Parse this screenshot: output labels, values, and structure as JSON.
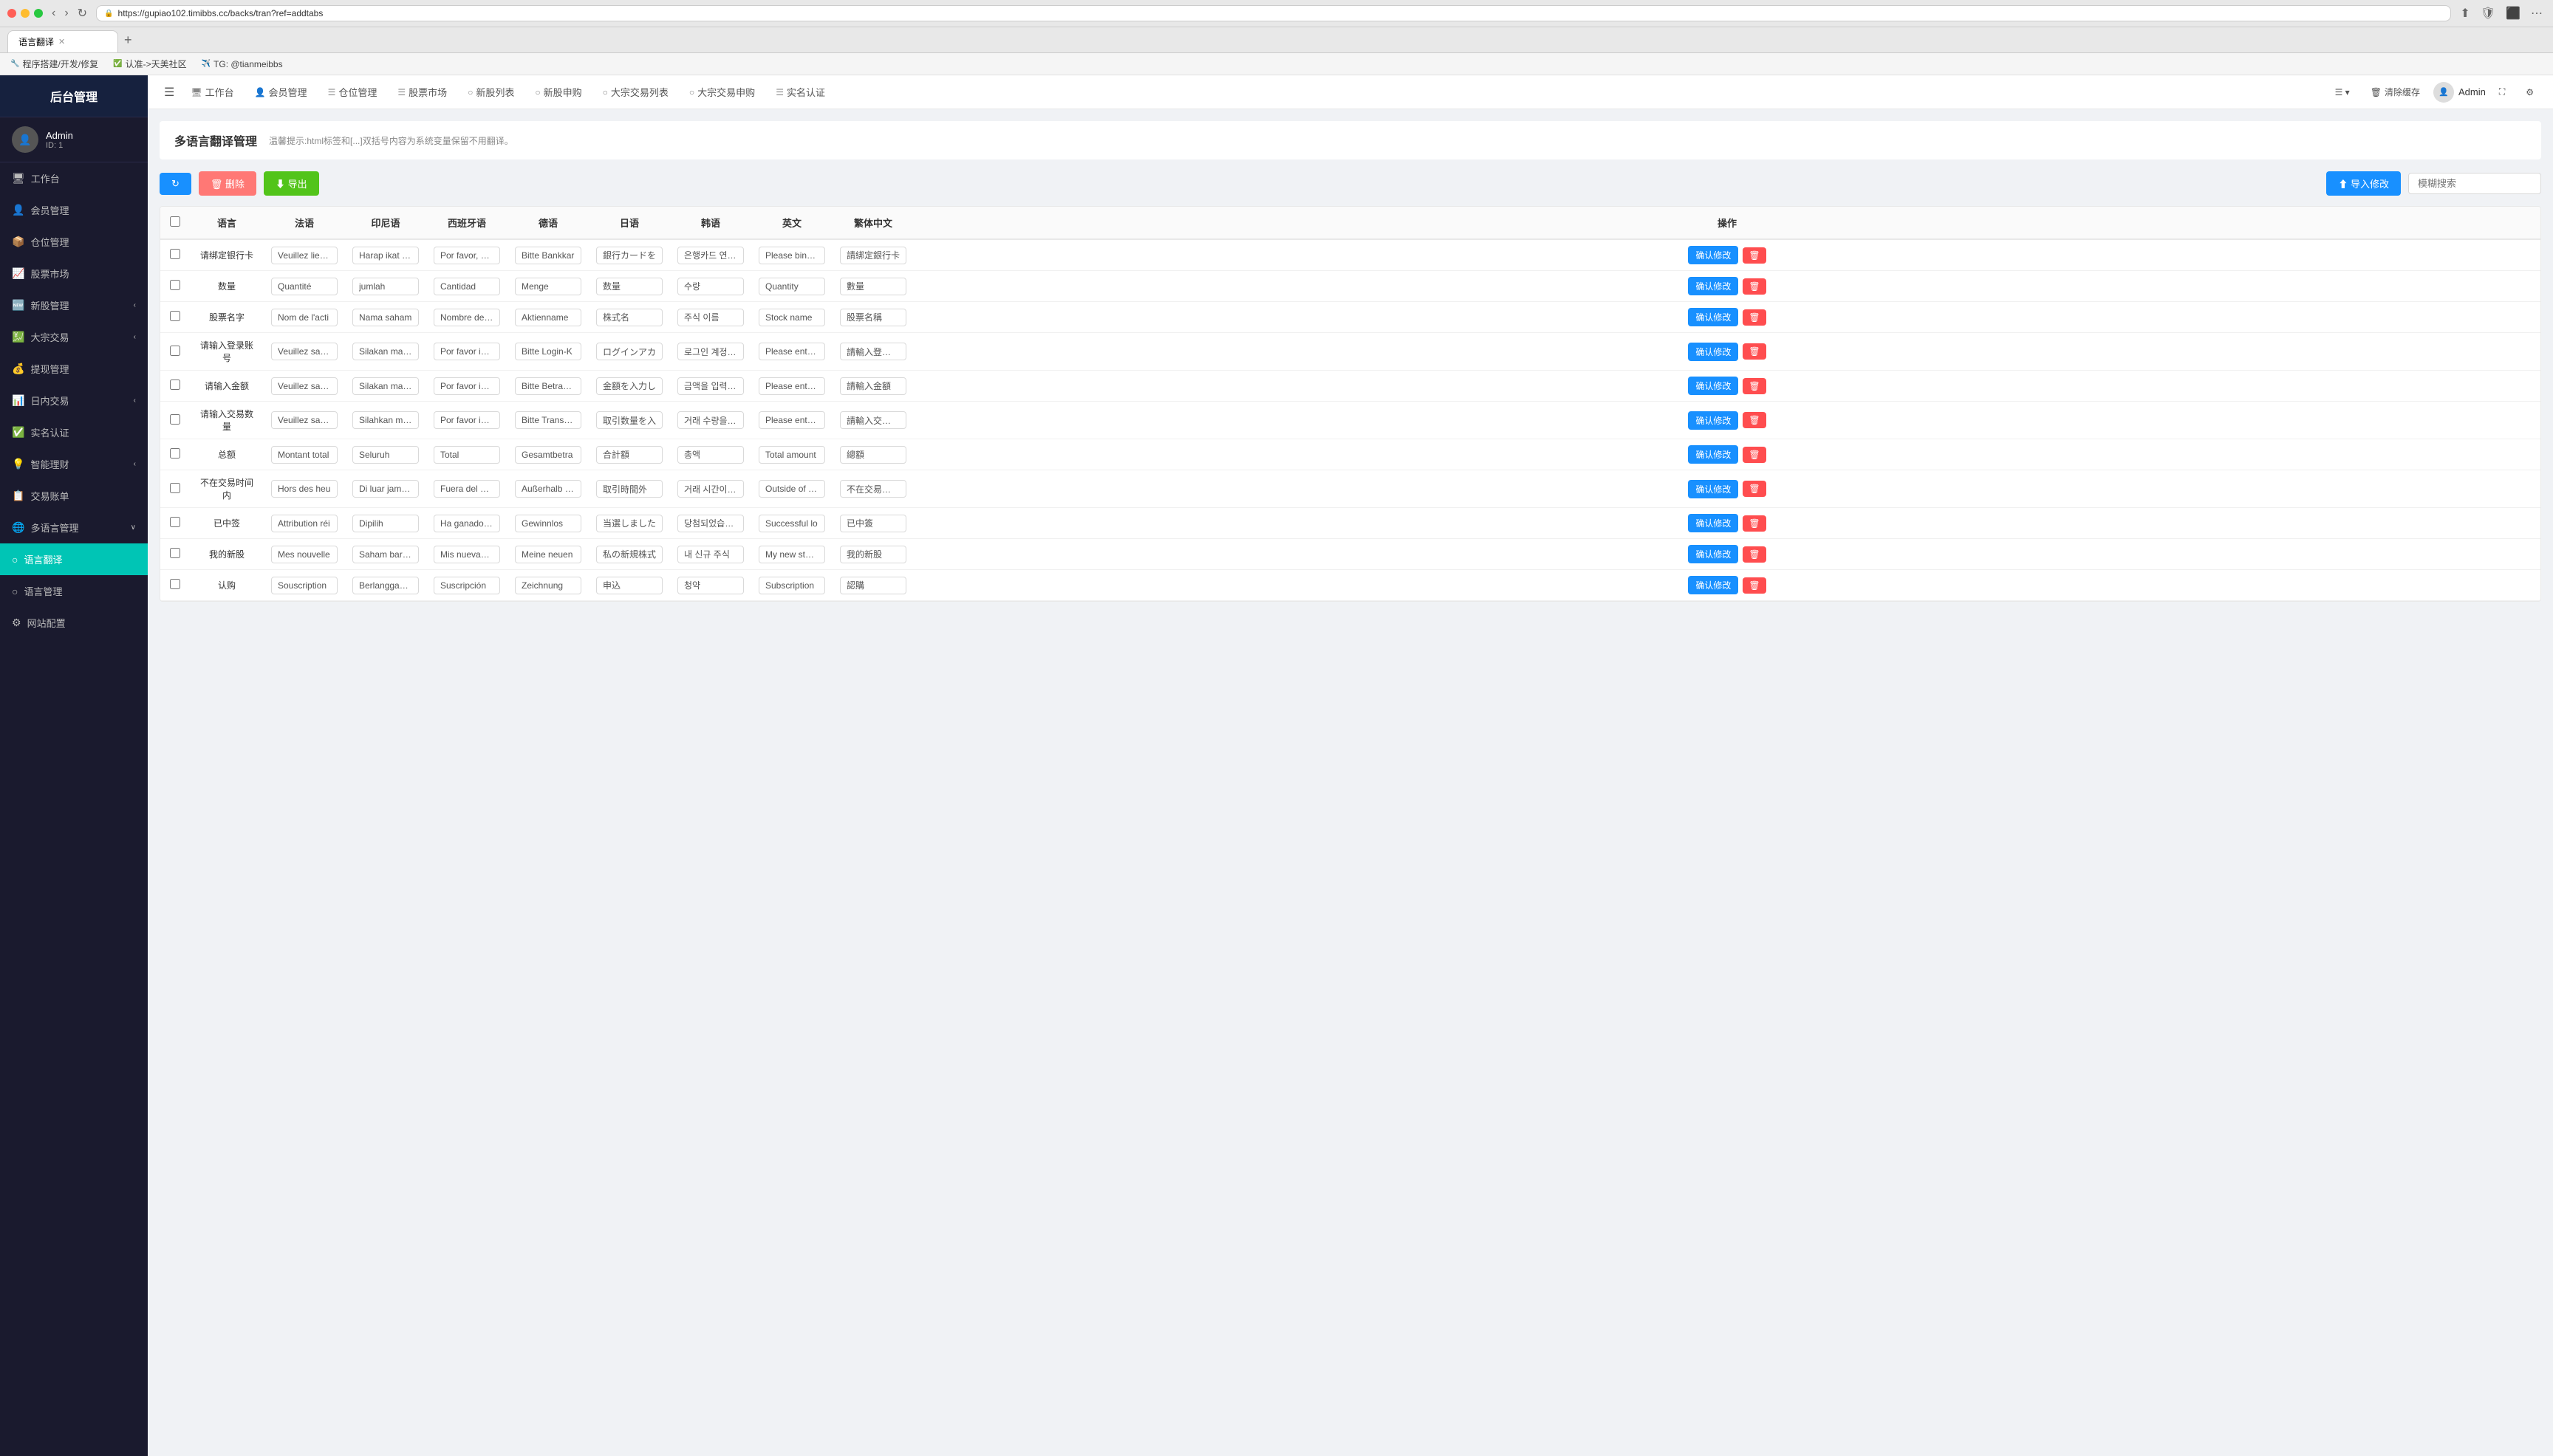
{
  "browser": {
    "url": "https://gupiao102.timibbs.cc/backs/tran?ref=addtabs",
    "tab_title": "语言翻译",
    "dots": [
      "red",
      "yellow",
      "green"
    ]
  },
  "bookmarks": [
    {
      "icon": "🔧",
      "label": "程序搭建/开发/修复"
    },
    {
      "icon": "✅",
      "label": "认准->天美社区"
    },
    {
      "icon": "✈️",
      "label": "TG: @tianmeibbs"
    }
  ],
  "topnav": {
    "hamburger": "☰",
    "items": [
      {
        "icon": "🖥",
        "label": "工作台"
      },
      {
        "icon": "👤",
        "label": "会员管理"
      },
      {
        "icon": "☰",
        "label": "仓位管理"
      },
      {
        "icon": "☰",
        "label": "股票市场"
      },
      {
        "icon": "○",
        "label": "新股列表"
      },
      {
        "icon": "○",
        "label": "新股申购"
      },
      {
        "icon": "○",
        "label": "大宗交易列表"
      },
      {
        "icon": "○",
        "label": "大宗交易申购"
      },
      {
        "icon": "☰",
        "label": "实名认证"
      }
    ],
    "right": {
      "layout_icon": "☰",
      "clear_cache": "清除缓存",
      "admin_label": "Admin",
      "fullscreen": "⛶",
      "settings": "⚙"
    }
  },
  "sidebar": {
    "logo": "后台管理",
    "user": {
      "name": "Admin",
      "id": "ID: 1"
    },
    "menu": [
      {
        "icon": "🖥",
        "label": "工作台",
        "active": false,
        "has_sub": false
      },
      {
        "icon": "👤",
        "label": "会员管理",
        "active": false,
        "has_sub": false
      },
      {
        "icon": "📦",
        "label": "仓位管理",
        "active": false,
        "has_sub": false
      },
      {
        "icon": "📈",
        "label": "股票市场",
        "active": false,
        "has_sub": false
      },
      {
        "icon": "🆕",
        "label": "新股管理",
        "active": false,
        "has_sub": true
      },
      {
        "icon": "💹",
        "label": "大宗交易",
        "active": false,
        "has_sub": true
      },
      {
        "icon": "💰",
        "label": "提现管理",
        "active": false,
        "has_sub": false
      },
      {
        "icon": "📊",
        "label": "日内交易",
        "active": false,
        "has_sub": true
      },
      {
        "icon": "✅",
        "label": "实名认证",
        "active": false,
        "has_sub": false
      },
      {
        "icon": "💡",
        "label": "智能理财",
        "active": false,
        "has_sub": true
      },
      {
        "icon": "📋",
        "label": "交易账单",
        "active": false,
        "has_sub": false
      },
      {
        "icon": "🌐",
        "label": "多语言管理",
        "active": false,
        "has_sub": true
      },
      {
        "icon": "○",
        "label": "语言翻译",
        "active": true,
        "has_sub": false
      },
      {
        "icon": "○",
        "label": "语言管理",
        "active": false,
        "has_sub": false
      },
      {
        "icon": "⚙",
        "label": "网站配置",
        "active": false,
        "has_sub": false
      }
    ]
  },
  "page": {
    "title": "多语言翻译管理",
    "hint": "温馨提示:html标签和[...]双括号内容为系统变量保留不用翻译。",
    "toolbar": {
      "refresh_label": "↻",
      "delete_label": "🗑 删除",
      "export_label": "⬇ 导出",
      "import_label": "⬆ 导入修改",
      "search_placeholder": "模糊搜索"
    },
    "table": {
      "columns": [
        "语言",
        "法语",
        "印尼语",
        "西班牙语",
        "德语",
        "日语",
        "韩语",
        "英文",
        "繁体中文",
        "操作"
      ],
      "rows": [
        {
          "source": "请绑定银行卡",
          "fr": "Veuillez lier vo",
          "id": "Harap ikat kar",
          "es": "Por favor, vincu",
          "de": "Bitte Bankkar",
          "ja": "銀行カードを",
          "ko": "은행카드 연결 하",
          "en": "Please bind y",
          "zh_tw": "請綁定銀行卡",
          "confirm_label": "确认修改"
        },
        {
          "source": "数量",
          "fr": "Quantité",
          "id": "jumlah",
          "es": "Cantidad",
          "de": "Menge",
          "ja": "数量",
          "ko": "수량",
          "en": "Quantity",
          "zh_tw": "數量",
          "confirm_label": "确认修改"
        },
        {
          "source": "股票名字",
          "fr": "Nom de l'acti",
          "id": "Nama saham",
          "es": "Nombre de la a",
          "de": "Aktienname",
          "ja": "株式名",
          "ko": "주식 이름",
          "en": "Stock name",
          "zh_tw": "股票名稱",
          "confirm_label": "确认修改"
        },
        {
          "source": "请输入登录账号",
          "fr": "Veuillez saisir",
          "id": "Silakan masuk",
          "es": "Por favor ingre",
          "de": "Bitte Login-K",
          "ja": "ログインアカ",
          "ko": "로그인 계정을 입",
          "en": "Please enter y",
          "zh_tw": "請輸入登錄帳號",
          "confirm_label": "确认修改"
        },
        {
          "source": "请输入金额",
          "fr": "Veuillez saisir",
          "id": "Silakan masuk",
          "es": "Por favor ingre",
          "de": "Bitte Betrag e",
          "ja": "金額を入力し",
          "ko": "금액을 입력해주",
          "en": "Please enter t",
          "zh_tw": "請輸入金額",
          "confirm_label": "确认修改"
        },
        {
          "source": "请输入交易数量",
          "fr": "Veuillez saisir",
          "id": "Silahkan masu",
          "es": "Por favor ingre",
          "de": "Bitte Transakt",
          "ja": "取引数量を入",
          "ko": "거래 수량을 입력",
          "en": "Please enter t",
          "zh_tw": "請輸入交易數量",
          "confirm_label": "确认修改"
        },
        {
          "source": "总额",
          "fr": "Montant total",
          "id": "Seluruh",
          "es": "Total",
          "de": "Gesamtbetra",
          "ja": "合計額",
          "ko": "총액",
          "en": "Total amount",
          "zh_tw": "總額",
          "confirm_label": "确认修改"
        },
        {
          "source": "不在交易时间内",
          "fr": "Hors des heu",
          "id": "Di luar jam pe",
          "es": "Fuera del horar",
          "de": "Außerhalb de",
          "ja": "取引時間外",
          "ko": "거래 시간이 아",
          "en": "Outside of tra",
          "zh_tw": "不在交易時間內",
          "confirm_label": "确认修改"
        },
        {
          "source": "已中签",
          "fr": "Attribution réi",
          "id": "Dipilih",
          "es": "Ha ganado la k",
          "de": "Gewinnlos",
          "ja": "当選しました",
          "ko": "당첨되었습니다",
          "en": "Successful lo",
          "zh_tw": "已中簽",
          "confirm_label": "确认修改"
        },
        {
          "source": "我的新股",
          "fr": "Mes nouvelle",
          "id": "Saham baru s",
          "es": "Mis nuevas acc",
          "de": "Meine neuen",
          "ja": "私の新規株式",
          "ko": "내 신규 주식",
          "en": "My new stock",
          "zh_tw": "我的新股",
          "confirm_label": "确认修改"
        },
        {
          "source": "认购",
          "fr": "Souscription",
          "id": "Berlangganan",
          "es": "Suscripción",
          "de": "Zeichnung",
          "ja": "申込",
          "ko": "청약",
          "en": "Subscription",
          "zh_tw": "認購",
          "confirm_label": "确认修改"
        }
      ]
    }
  }
}
